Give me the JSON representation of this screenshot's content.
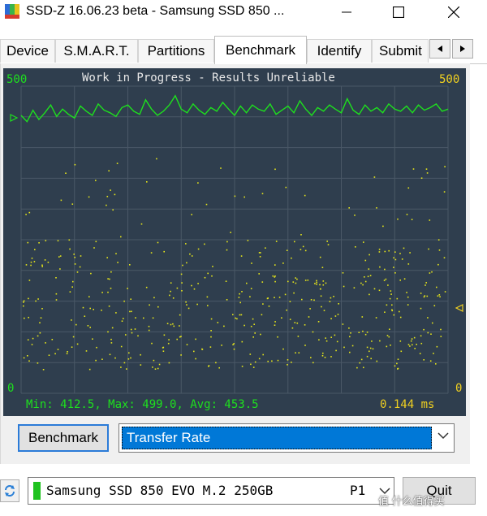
{
  "window": {
    "title": "SSD-Z 16.06.23 beta - Samsung SSD 850 ...",
    "icon": "ssdz-app-icon",
    "controls": [
      "minimize-icon",
      "maximize-icon",
      "close-icon"
    ]
  },
  "tabs": [
    {
      "label": "Device"
    },
    {
      "label": "S.M.A.R.T."
    },
    {
      "label": "Partitions"
    },
    {
      "label": "Benchmark",
      "active": true
    },
    {
      "label": "Identify"
    },
    {
      "label": "Submit"
    }
  ],
  "graph": {
    "y_max_left": "500",
    "y_max_right": "500",
    "y_min_left": "0",
    "y_min_right": "0",
    "status": "Work in Progress - Results Unreliable",
    "stats": "Min: 412.5, Max: 499.0, Avg: 453.5",
    "latency": "0.144 ms",
    "colors": {
      "background": "#2f3e4e",
      "grid": "#4a5867",
      "line": "#1ee01e",
      "points": "#e6e61a",
      "text": "#1ee01e",
      "latency_text": "#f0d020",
      "status_text": "#e8e8e8"
    }
  },
  "chart_data": {
    "type": "line",
    "series": [
      {
        "values": [
          450,
          438,
          460,
          442,
          455,
          470,
          448,
          462,
          452,
          445,
          468,
          458,
          450,
          472,
          460,
          455,
          448,
          465,
          470,
          458,
          452,
          480,
          462,
          450,
          458,
          470,
          488,
          462,
          455,
          472,
          460,
          452,
          465,
          458,
          475,
          462,
          450,
          468,
          455,
          470,
          462,
          458,
          472,
          452,
          460,
          468,
          455,
          478,
          462,
          450,
          465,
          458,
          470,
          462,
          455,
          482,
          460,
          452,
          470,
          458,
          465,
          455,
          472,
          462,
          458,
          468,
          455,
          470,
          460,
          465,
          472,
          458,
          462
        ]
      }
    ],
    "ylim": [
      0,
      500
    ],
    "grid": true
  },
  "controls": {
    "benchmark_button": "Benchmark",
    "mode_select": "Transfer Rate"
  },
  "bottom": {
    "drive_name": "Samsung SSD 850 EVO M.2 250GB",
    "partition": "P1",
    "quit_button": "Quit",
    "watermark": "值 什么值得买"
  }
}
